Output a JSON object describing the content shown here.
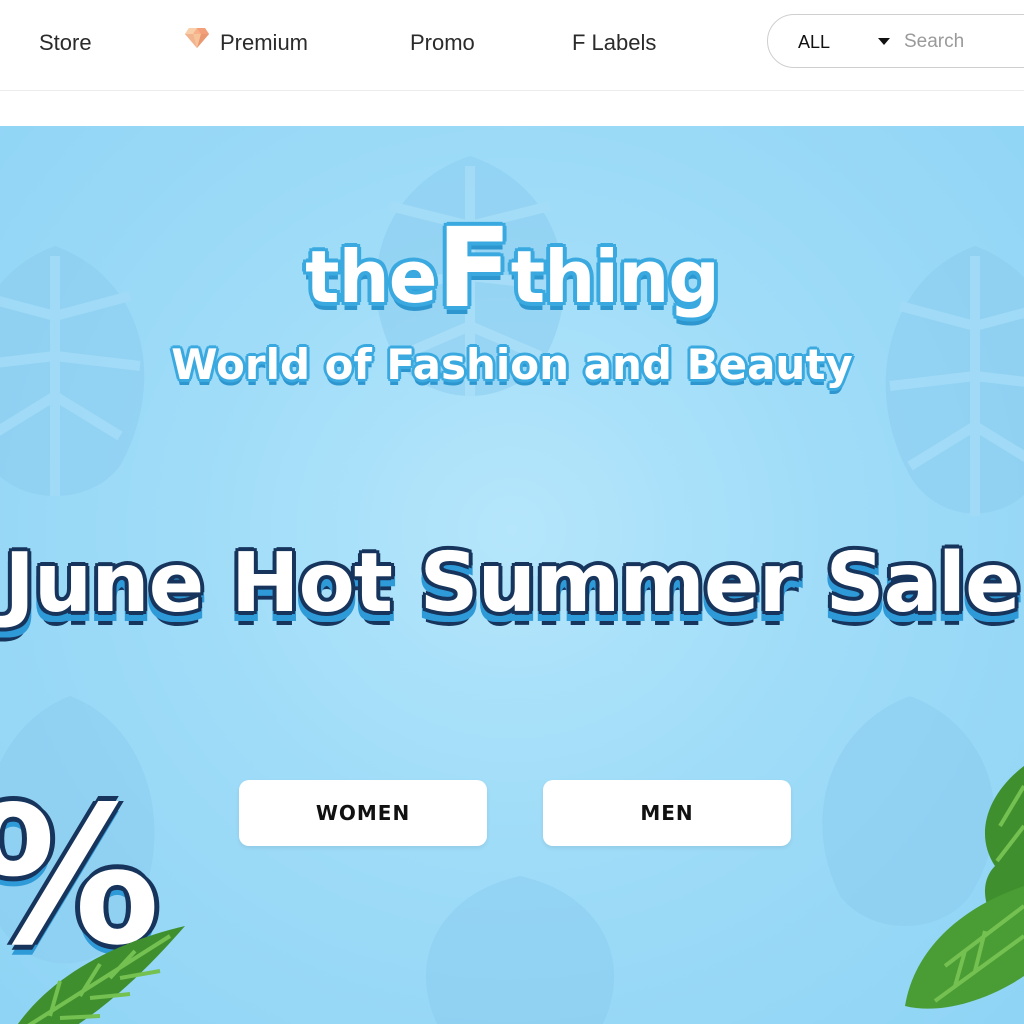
{
  "nav": {
    "items": [
      {
        "label": "Store"
      },
      {
        "label": "Premium",
        "icon": "diamond-icon"
      },
      {
        "label": "Promo"
      },
      {
        "label": "F Labels"
      }
    ]
  },
  "search": {
    "scope": "ALL",
    "placeholder": "Search"
  },
  "hero": {
    "logo_prefix": "the",
    "logo_f": "F",
    "logo_suffix": "thing",
    "tagline": "World of Fashion and Beauty",
    "headline": "June Hot Summer Sale",
    "percent_fragment": "%",
    "buttons": {
      "women": "WOMEN",
      "men": "MEN"
    }
  },
  "colors": {
    "hero_bg": "#9fdcf8",
    "logo_outline": "#3aa9e0",
    "headline_outline": "#17355c",
    "leaf_green": "#3f8f2f"
  }
}
